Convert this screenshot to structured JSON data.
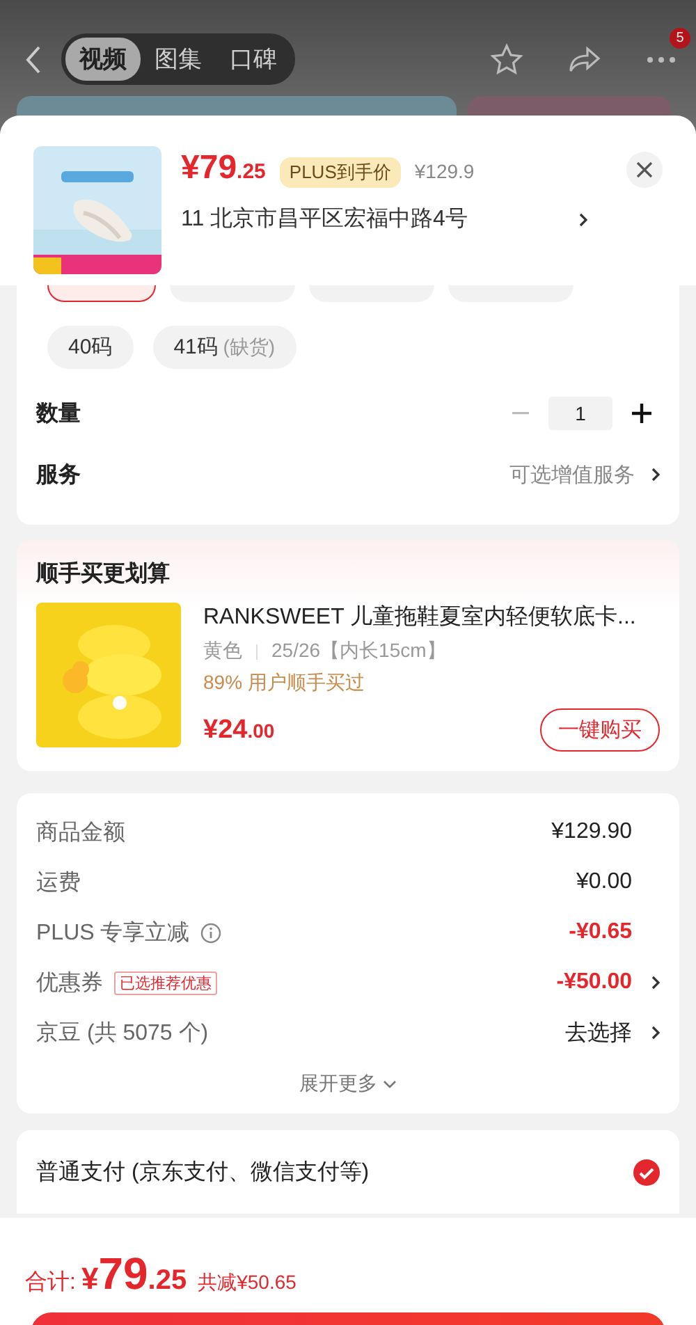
{
  "top_bar": {
    "tabs": [
      {
        "label": "视频",
        "selected": true
      },
      {
        "label": "图集",
        "selected": false
      },
      {
        "label": "口碑",
        "selected": false
      }
    ],
    "more_badge": "5"
  },
  "product": {
    "price_int": "¥79",
    "price_dec": ".25",
    "plus_tag": "PLUS到手价",
    "original_price": "¥129.9",
    "address": "11  北京市昌平区宏福中路4号"
  },
  "sizes_cut_row": [
    {
      "selected": true
    },
    {
      "selected": false
    },
    {
      "selected": false
    },
    {
      "selected": false
    }
  ],
  "sizes": [
    {
      "label": "40码",
      "selected": false
    },
    {
      "label": "41码",
      "note": "(缺货)",
      "selected": false
    }
  ],
  "quantity": {
    "label": "数量",
    "value": "1",
    "minus_disabled": true
  },
  "service": {
    "label": "服务",
    "value": "可选增值服务"
  },
  "addon": {
    "title": "顺手买更划算",
    "name": "RANKSWEET 儿童拖鞋夏室内轻便软底卡...",
    "spec_color": "黄色",
    "spec_size": "25/26【内长15cm】",
    "note": "89% 用户顺手买过",
    "price_int": "¥24",
    "price_dec": ".00",
    "button": "一键购买"
  },
  "fees": [
    {
      "label": "商品金额",
      "value": "¥129.90",
      "discount": false,
      "info": false,
      "arrow": false
    },
    {
      "label": "运费",
      "value": "¥0.00",
      "discount": false,
      "info": false,
      "arrow": false
    },
    {
      "label": "PLUS 专享立减",
      "value": "-¥0.65",
      "discount": true,
      "info": true,
      "arrow": false
    },
    {
      "label": "优惠券",
      "value": "-¥50.00",
      "discount": true,
      "info": false,
      "tag": "已选推荐优惠",
      "arrow": true
    },
    {
      "label": "京豆 (共 5075 个)",
      "value": "去选择",
      "discount": false,
      "info": false,
      "arrow": true
    }
  ],
  "expand": "展开更多",
  "payment": {
    "label": "普通支付 (京东支付、微信支付等)",
    "checked": true
  },
  "total": {
    "label": "合计:",
    "price_int": "¥79",
    "price_dec": ".25",
    "saved": "共减¥50.65"
  }
}
